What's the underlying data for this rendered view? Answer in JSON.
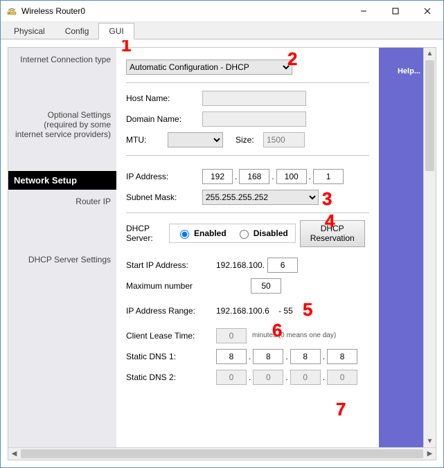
{
  "window": {
    "title": "Wireless Router0"
  },
  "tabs": {
    "physical": "Physical",
    "config": "Config",
    "gui": "GUI"
  },
  "sidebar": {
    "internet_conn_type": "Internet Connection type",
    "optional_settings": "Optional Settings (required by some internet service providers)",
    "banner": "Network Setup",
    "router_ip": "Router IP",
    "dhcp_server_settings": "DHCP Server Settings"
  },
  "help": {
    "label": "Help..."
  },
  "internet": {
    "connection_type_value": "Automatic Configuration - DHCP",
    "host_name_label": "Host Name:",
    "host_name_value": "",
    "domain_name_label": "Domain Name:",
    "domain_name_value": "",
    "mtu_label": "MTU:",
    "mtu_select": "",
    "size_label": "Size:",
    "size_value": "1500"
  },
  "router_ip": {
    "ip_label": "IP Address:",
    "ip": [
      "192",
      "168",
      "100",
      "1"
    ],
    "subnet_label": "Subnet Mask:",
    "subnet_value": "255.255.255.252"
  },
  "dhcp": {
    "server_label": "DHCP Server:",
    "enabled_label": "Enabled",
    "disabled_label": "Disabled",
    "reservation_btn": "DHCP Reservation",
    "start_ip_label": "Start IP Address:",
    "start_ip_prefix": "192.168.100.",
    "start_ip_last": "6",
    "max_label": "Maximum number",
    "max_value": "50",
    "range_label": "IP Address Range:",
    "range_value": "192.168.100.6    - 55",
    "lease_label": "Client Lease Time:",
    "lease_value": "0",
    "lease_units": "minutes (0 means one day)",
    "dns1_label": "Static DNS 1:",
    "dns1": [
      "8",
      "8",
      "8",
      "8"
    ],
    "dns2_label": "Static DNS 2:",
    "dns2": [
      "0",
      "0",
      "0",
      "0"
    ]
  },
  "annotations": {
    "1": "1",
    "2": "2",
    "3": "3",
    "4": "4",
    "5": "5",
    "6": "6",
    "7": "7"
  }
}
